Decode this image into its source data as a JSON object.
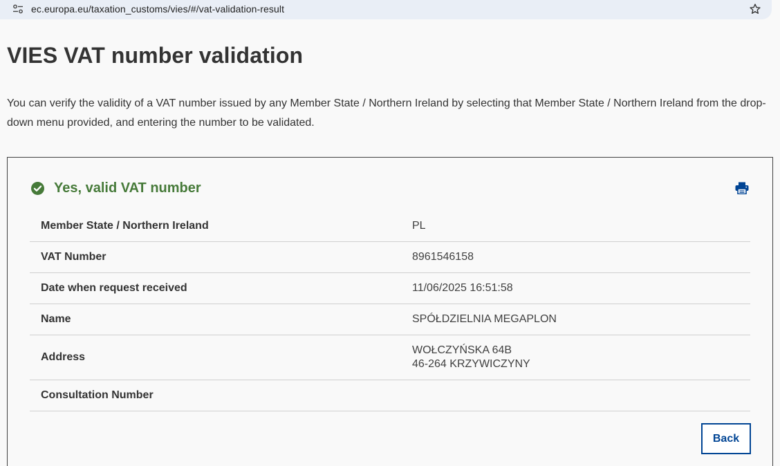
{
  "browser": {
    "url": "ec.europa.eu/taxation_customs/vies/#/vat-validation-result"
  },
  "page": {
    "title": "VIES VAT number validation",
    "intro": "You can verify the validity of a VAT number issued by any Member State / Northern Ireland by selecting that Member State / Northern Ireland from the drop-down menu provided, and entering the number to be validated."
  },
  "result": {
    "status": "Yes, valid VAT number",
    "status_color": "#467a39",
    "rows": [
      {
        "label": "Member State / Northern Ireland",
        "value": "PL"
      },
      {
        "label": "VAT Number",
        "value": "8961546158"
      },
      {
        "label": "Date when request received",
        "value": "11/06/2025 16:51:58"
      },
      {
        "label": "Name",
        "value": "SPÓŁDZIELNIA MEGAPLON"
      },
      {
        "label": "Address",
        "value_lines": [
          "WOŁCZYŃSKA 64B",
          "46-264 KRZYWICZYNY"
        ]
      },
      {
        "label": "Consultation Number",
        "value": ""
      }
    ],
    "back_label": "Back",
    "accent_color": "#004494"
  }
}
